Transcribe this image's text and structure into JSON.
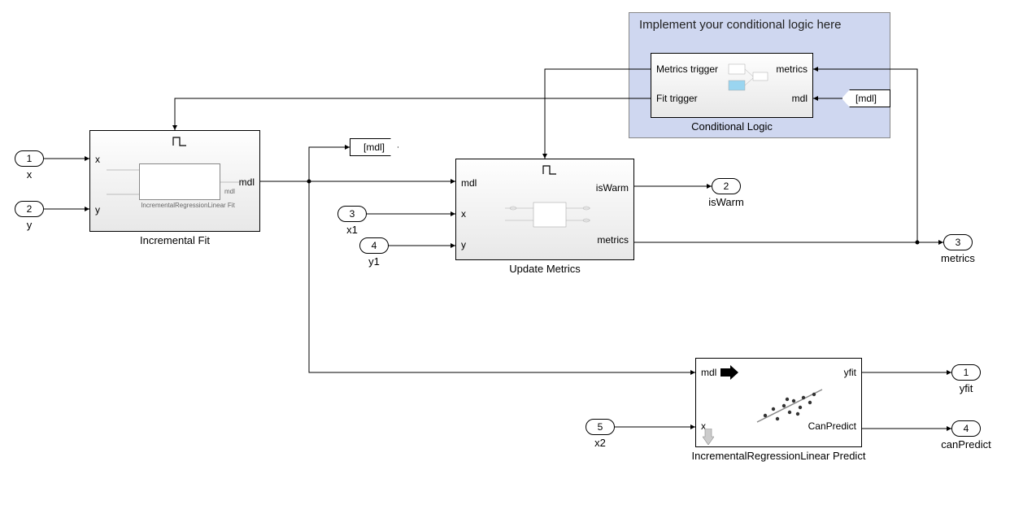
{
  "annotation": {
    "text": "Implement your conditional logic here"
  },
  "inports": {
    "p1": {
      "num": "1",
      "name": "x"
    },
    "p2": {
      "num": "2",
      "name": "y"
    },
    "p3": {
      "num": "3",
      "name": "x1"
    },
    "p4": {
      "num": "4",
      "name": "y1"
    },
    "p5": {
      "num": "5",
      "name": "x2"
    }
  },
  "outports": {
    "o1": {
      "num": "1",
      "name": "yfit"
    },
    "o2": {
      "num": "2",
      "name": "isWarm"
    },
    "o3": {
      "num": "3",
      "name": "metrics"
    },
    "o4": {
      "num": "4",
      "name": "canPredict"
    }
  },
  "blocks": {
    "incFit": {
      "label": "Incremental Fit",
      "port_x": "x",
      "port_y": "y",
      "port_mdl": "mdl",
      "inner_label": "IncrementalRegressionLinear Fit"
    },
    "updateMetrics": {
      "label": "Update Metrics",
      "port_mdl": "mdl",
      "port_x": "x",
      "port_y": "y",
      "port_isWarm": "isWarm",
      "port_metrics": "metrics"
    },
    "condLogic": {
      "label": "Conditional Logic",
      "port_metrics_trigger": "Metrics trigger",
      "port_fit_trigger": "Fit trigger",
      "port_metrics": "metrics",
      "port_mdl": "mdl"
    },
    "predict": {
      "label": "IncrementalRegressionLinear Predict",
      "port_mdl": "mdl",
      "port_x": "x",
      "port_yfit": "yfit",
      "port_canPredict": "CanPredict"
    }
  },
  "tags": {
    "mdl_goto": "[mdl]",
    "mdl_from": "[mdl]"
  }
}
